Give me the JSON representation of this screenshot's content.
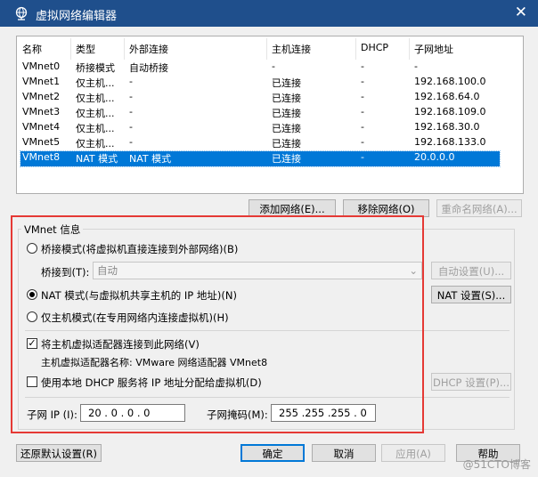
{
  "window": {
    "title": "虚拟网络编辑器",
    "close_glyph": "✕"
  },
  "table": {
    "headers": [
      "名称",
      "类型",
      "外部连接",
      "主机连接",
      "DHCP",
      "子网地址"
    ],
    "rows": [
      [
        "VMnet0",
        "桥接模式",
        "自动桥接",
        "-",
        "-",
        "-"
      ],
      [
        "VMnet1",
        "仅主机...",
        "-",
        "已连接",
        "-",
        "192.168.100.0"
      ],
      [
        "VMnet2",
        "仅主机...",
        "-",
        "已连接",
        "-",
        "192.168.64.0"
      ],
      [
        "VMnet3",
        "仅主机...",
        "-",
        "已连接",
        "-",
        "192.168.109.0"
      ],
      [
        "VMnet4",
        "仅主机...",
        "-",
        "已连接",
        "-",
        "192.168.30.0"
      ],
      [
        "VMnet5",
        "仅主机...",
        "-",
        "已连接",
        "-",
        "192.168.133.0"
      ],
      [
        "VMnet8",
        "NAT 模式",
        "NAT 模式",
        "已连接",
        "-",
        "20.0.0.0"
      ]
    ],
    "selected_row": 6
  },
  "table_buttons": {
    "add": "添加网络(E)...",
    "remove": "移除网络(O)",
    "rename": "重命名网络(A)..."
  },
  "vmnet_info": {
    "legend": "VMnet 信息",
    "bridge_radio": "桥接模式(将虚拟机直接连接到外部网络)(B)",
    "bridge_to_label": "桥接到(T):",
    "bridge_to_value": "自动",
    "auto_settings_button": "自动设置(U)...",
    "nat_radio": "NAT 模式(与虚拟机共享主机的 IP 地址)(N)",
    "nat_settings_button": "NAT 设置(S)...",
    "hostonly_radio": "仅主机模式(在专用网络内连接虚拟机)(H)",
    "connect_adapter_checkbox": "将主机虚拟适配器连接到此网络(V)",
    "adapter_name_text": "主机虚拟适配器名称: VMware 网络适配器 VMnet8",
    "dhcp_checkbox": "使用本地 DHCP 服务将 IP 地址分配给虚拟机(D)",
    "dhcp_settings_button": "DHCP 设置(P)...",
    "subnet_ip_label": "子网 IP (I):",
    "subnet_ip_value": "20 . 0 . 0 . 0",
    "subnet_mask_label": "子网掩码(M):",
    "subnet_mask_value": "255 .255 .255 . 0",
    "selected_mode": "nat",
    "connect_adapter_checked": true,
    "dhcp_checked": false
  },
  "footer": {
    "restore": "还原默认设置(R)",
    "ok": "确定",
    "cancel": "取消",
    "apply": "应用(A)",
    "help": "帮助"
  },
  "watermark": "@51CTO博客",
  "colors": {
    "titlebar": "#1f4f8c",
    "selection": "#0078d7",
    "highlight_box": "#e53935"
  }
}
